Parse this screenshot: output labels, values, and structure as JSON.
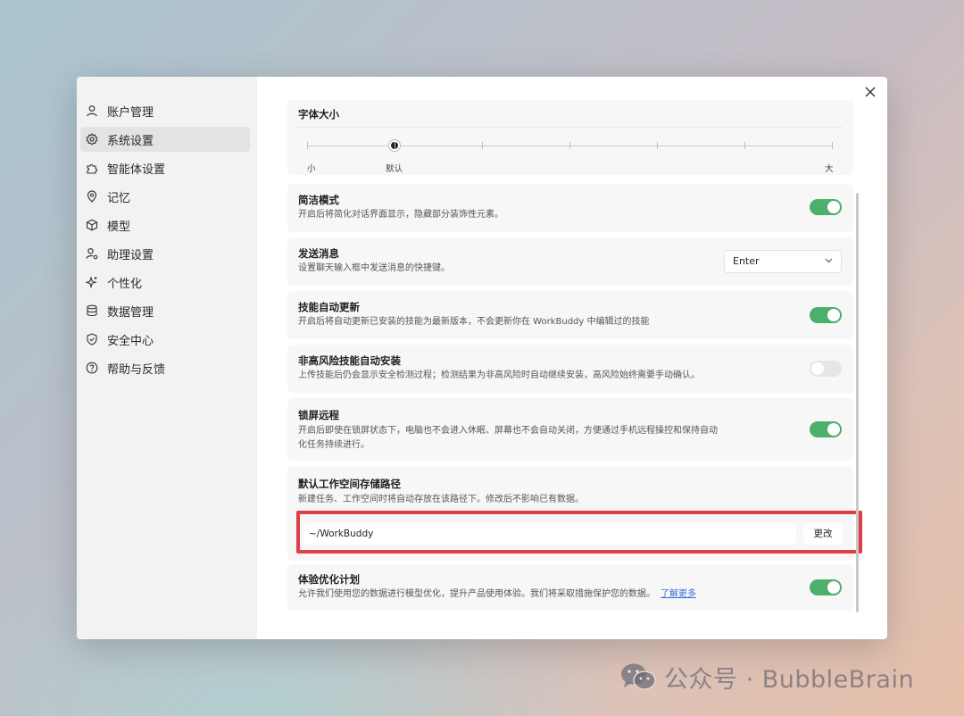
{
  "sidebar": {
    "items": [
      {
        "label": "账户管理",
        "icon": "user-icon"
      },
      {
        "label": "系统设置",
        "icon": "gear-icon",
        "active": true
      },
      {
        "label": "智能体设置",
        "icon": "puzzle-icon"
      },
      {
        "label": "记忆",
        "icon": "brain-pin-icon"
      },
      {
        "label": "模型",
        "icon": "cube-icon"
      },
      {
        "label": "助理设置",
        "icon": "user-gear-icon"
      },
      {
        "label": "个性化",
        "icon": "sparkle-icon"
      },
      {
        "label": "数据管理",
        "icon": "database-icon"
      },
      {
        "label": "安全中心",
        "icon": "shield-icon"
      },
      {
        "label": "帮助与反馈",
        "icon": "help-circle-icon"
      }
    ]
  },
  "font_size": {
    "title": "字体大小",
    "labels": {
      "small": "小",
      "default": "默认",
      "large": "大"
    },
    "steps": 7,
    "selected_step": 2
  },
  "settings": {
    "compact_mode": {
      "title": "简洁模式",
      "desc": "开启后将简化对话界面显示，隐藏部分装饰性元素。",
      "enabled": true
    },
    "send_message": {
      "title": "发送消息",
      "desc": "设置聊天输入框中发送消息的快捷键。",
      "value": "Enter"
    },
    "skill_auto_update": {
      "title": "技能自动更新",
      "desc": "开启后将自动更新已安装的技能为最新版本，不会更新你在 WorkBuddy 中编辑过的技能",
      "enabled": true
    },
    "non_high_risk_install": {
      "title": "非高风险技能自动安装",
      "desc": "上传技能后仍会显示安全检测过程；检测结果为非高风险时自动继续安装，高风险始终需要手动确认。",
      "enabled": false
    },
    "lock_screen_remote": {
      "title": "锁屏远程",
      "desc_line1": "开启后即使在锁屏状态下，电脑也不会进入休眠、屏幕也不会自动关闭，方便通过手机远程操控和保持自动",
      "desc_line2": "化任务持续进行。",
      "enabled": true
    },
    "workspace_path": {
      "title": "默认工作空间存储路径",
      "desc": "新建任务、工作空间时将自动存放在该路径下。修改后不影响已有数据。",
      "value": "~/WorkBuddy",
      "button": "更改"
    },
    "experience_plan": {
      "title": "体验优化计划",
      "desc": "允许我们使用您的数据进行模型优化，提升产品使用体验。我们将采取措施保护您的数据。",
      "link": "了解更多",
      "enabled": true
    }
  },
  "colors": {
    "toggle_on": "#4caf6a",
    "highlight": "#e03e45",
    "link": "#3a6fd8"
  },
  "watermark": {
    "text": "公众号 · BubbleBrain",
    "icon": "wechat-icon"
  }
}
